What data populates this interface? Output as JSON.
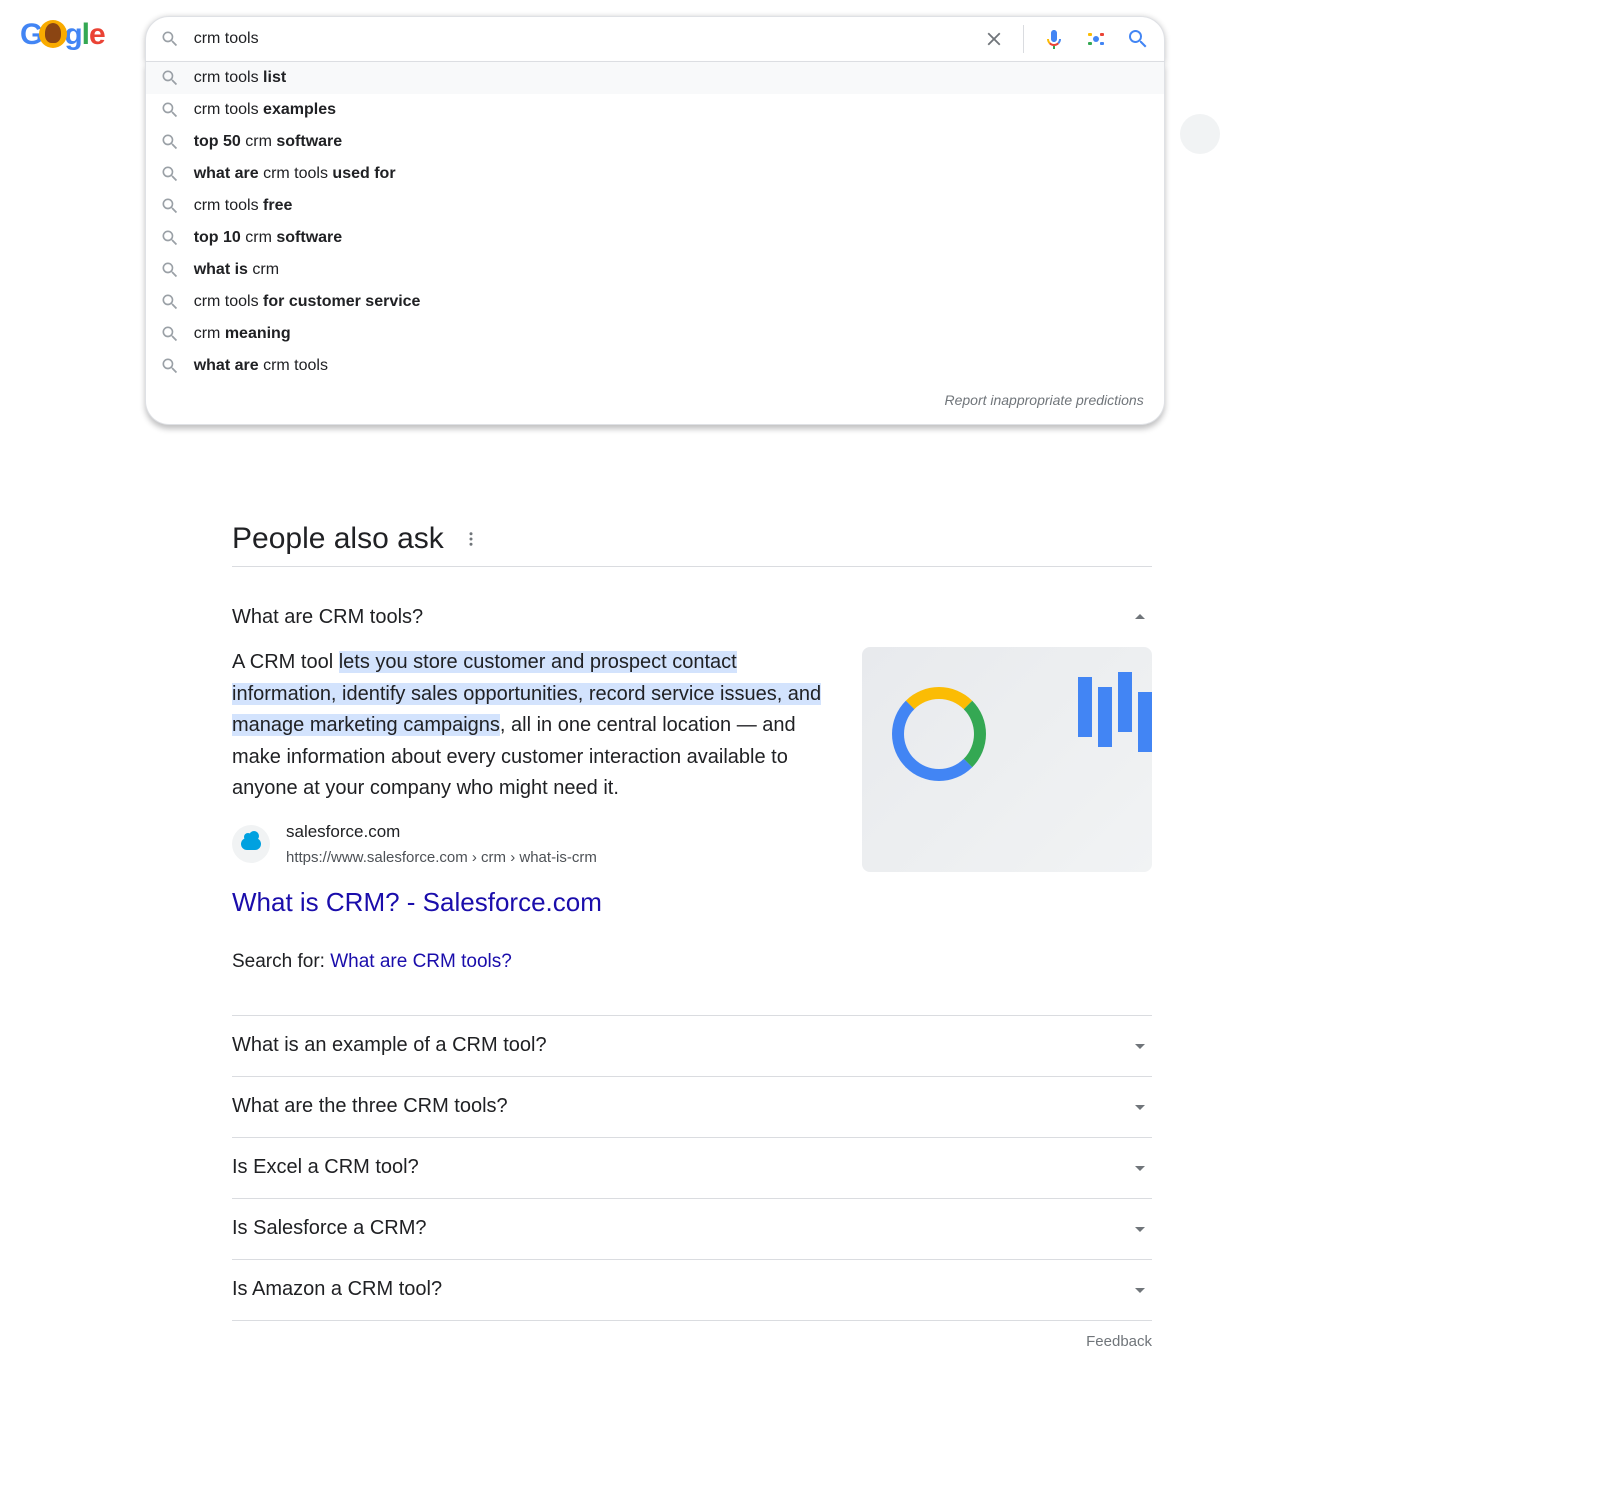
{
  "search": {
    "query": "crm tools",
    "suggestions": [
      {
        "pre": "crm tools ",
        "bold": "list",
        "post": ""
      },
      {
        "pre": "crm tools ",
        "bold": "examples",
        "post": ""
      },
      {
        "pre": "",
        "bold": "top 50",
        "mid": " crm ",
        "bold2": "software",
        "post": ""
      },
      {
        "pre": "",
        "bold": "what are",
        "mid": " crm tools ",
        "bold2": "used for",
        "post": ""
      },
      {
        "pre": "crm tools ",
        "bold": "free",
        "post": ""
      },
      {
        "pre": "",
        "bold": "top 10",
        "mid": " crm ",
        "bold2": "software",
        "post": ""
      },
      {
        "pre": "",
        "bold": "what is",
        "mid": " crm",
        "bold2": "",
        "post": ""
      },
      {
        "pre": "crm tools ",
        "bold": "for customer service",
        "post": ""
      },
      {
        "pre": "crm ",
        "bold": "meaning",
        "post": ""
      },
      {
        "pre": "",
        "bold": "what are",
        "mid": " crm tools",
        "bold2": "",
        "post": ""
      }
    ],
    "report_text": "Report inappropriate predictions"
  },
  "paa": {
    "heading": "People also ask",
    "expanded": {
      "question": "What are CRM tools?",
      "answer_pre": "A CRM tool ",
      "answer_hl": "lets you store customer and prospect contact information, identify sales opportunities, record service issues, and manage marketing campaigns",
      "answer_post": ", all in one central location — and make information about every customer interaction available to anyone at your company who might need it.",
      "source_name": "salesforce.com",
      "source_url": "https://www.salesforce.com › crm › what-is-crm",
      "source_title": "What is CRM? - Salesforce.com",
      "search_for_label": "Search for: ",
      "search_for_link": "What are CRM tools?"
    },
    "collapsed": [
      "What is an example of a CRM tool?",
      "What are the three CRM tools?",
      "Is Excel a CRM tool?",
      "Is Salesforce a CRM?",
      "Is Amazon a CRM tool?"
    ],
    "feedback": "Feedback"
  }
}
